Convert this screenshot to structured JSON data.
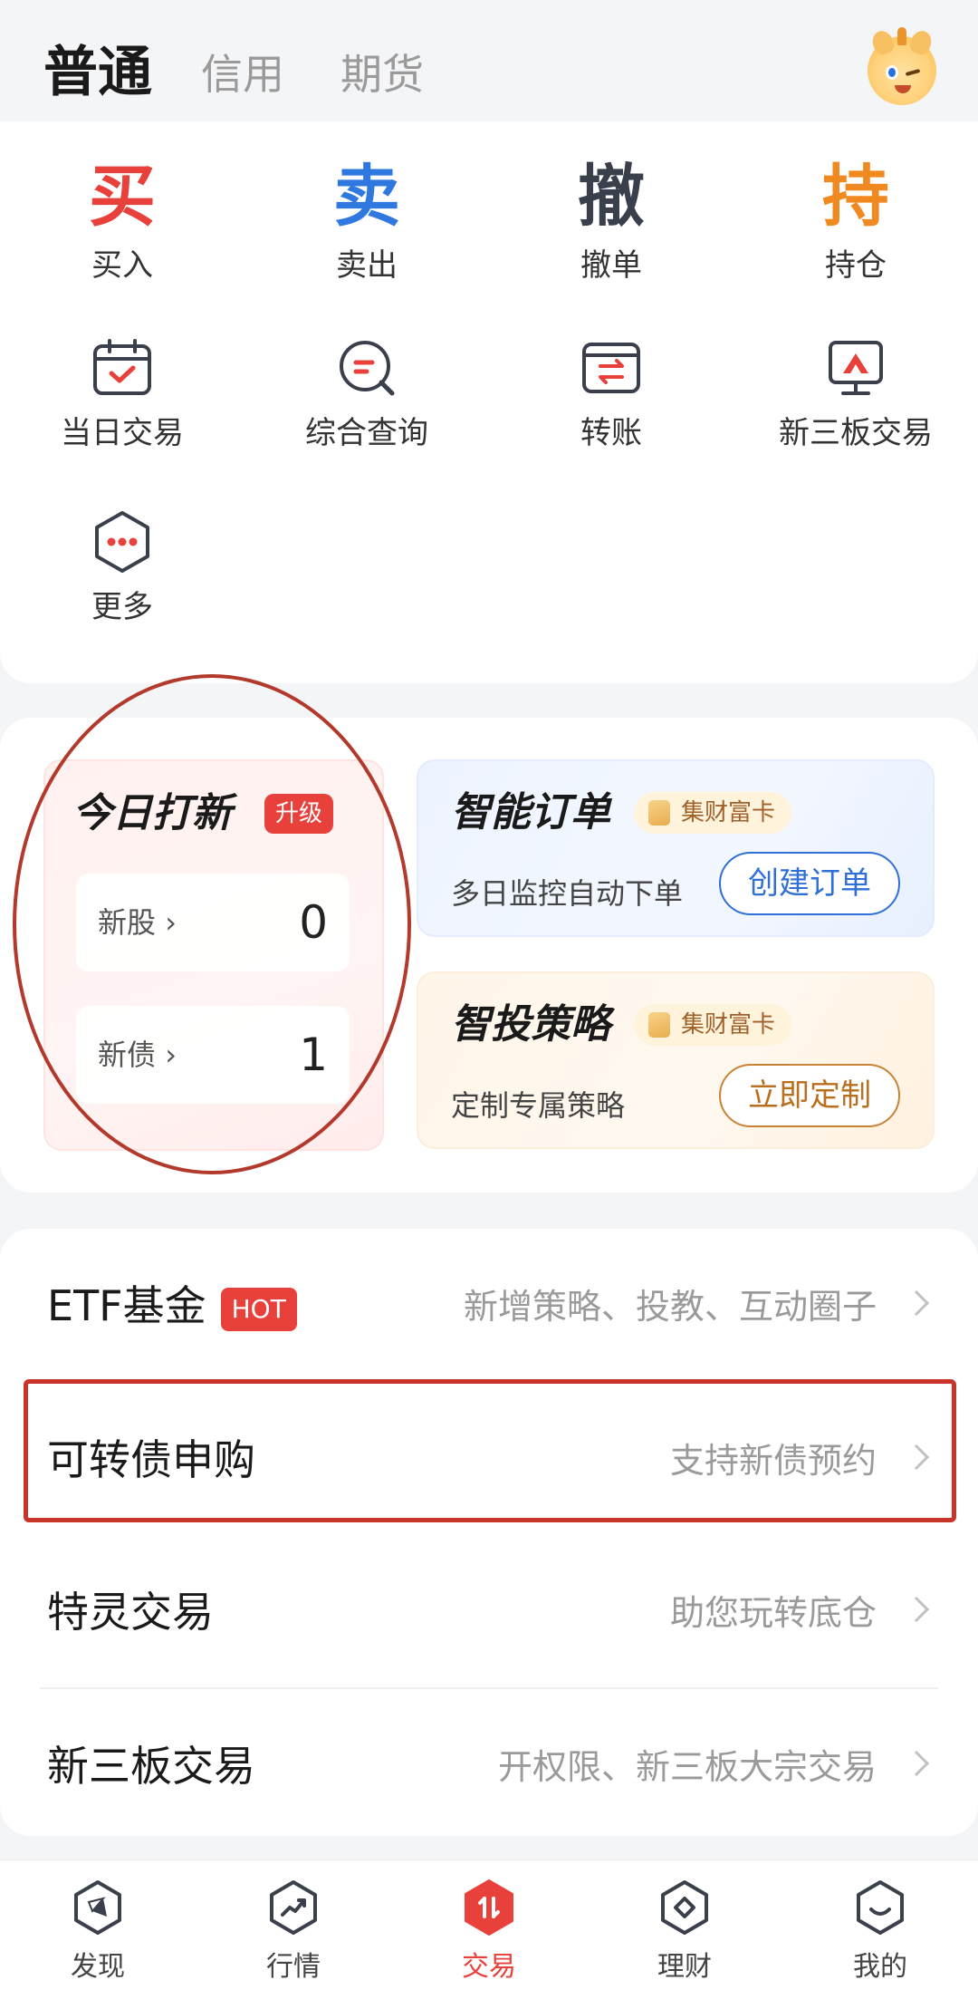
{
  "header": {
    "tabs": [
      {
        "label": "普通",
        "active": true
      },
      {
        "label": "信用",
        "active": false
      },
      {
        "label": "期货",
        "active": false
      }
    ],
    "avatar_icon": "cartoon-avatar-icon"
  },
  "actions": [
    {
      "glyph": "买",
      "label": "买入",
      "color": "#e8403a"
    },
    {
      "glyph": "卖",
      "label": "卖出",
      "color": "#2f78e0"
    },
    {
      "glyph": "撤",
      "label": "撤单",
      "color": "#3a3f4c"
    },
    {
      "glyph": "持",
      "label": "持仓",
      "color": "#f0891f"
    }
  ],
  "tools": [
    {
      "label": "当日交易",
      "icon": "calendar-check-icon"
    },
    {
      "label": "综合查询",
      "icon": "search-query-icon"
    },
    {
      "label": "转账",
      "icon": "transfer-icon"
    },
    {
      "label": "新三板交易",
      "icon": "monitor-chart-icon"
    },
    {
      "label": "更多",
      "icon": "more-hexagon-icon"
    }
  ],
  "ipo": {
    "title": "今日打新",
    "badge": "升级",
    "rows": [
      {
        "label": "新股",
        "value": "0"
      },
      {
        "label": "新债",
        "value": "1"
      }
    ]
  },
  "features": [
    {
      "title": "智能订单",
      "pill": "集财富卡",
      "subtitle": "多日监控自动下单",
      "button": "创建订单"
    },
    {
      "title": "智投策略",
      "pill": "集财富卡",
      "subtitle": "定制专属策略",
      "button": "立即定制"
    }
  ],
  "list": [
    {
      "title": "ETF基金",
      "badge": "HOT",
      "desc": "新增策略、投教、互动圈子"
    },
    {
      "title": "可转债申购",
      "desc": "支持新债预约"
    },
    {
      "title": "特灵交易",
      "desc": "助您玩转底仓"
    },
    {
      "title": "新三板交易",
      "desc": "开权限、新三板大宗交易"
    }
  ],
  "nav": [
    {
      "label": "发现",
      "icon": "compass-icon",
      "active": false
    },
    {
      "label": "行情",
      "icon": "trend-icon",
      "active": false
    },
    {
      "label": "交易",
      "icon": "trade-icon",
      "active": true
    },
    {
      "label": "理财",
      "icon": "diamond-icon",
      "active": false
    },
    {
      "label": "我的",
      "icon": "smile-icon",
      "active": false
    }
  ],
  "colors": {
    "accent_red": "#e8403a",
    "annotation_red": "#c9342a",
    "blue": "#2f78e0",
    "orange": "#f0891f"
  }
}
